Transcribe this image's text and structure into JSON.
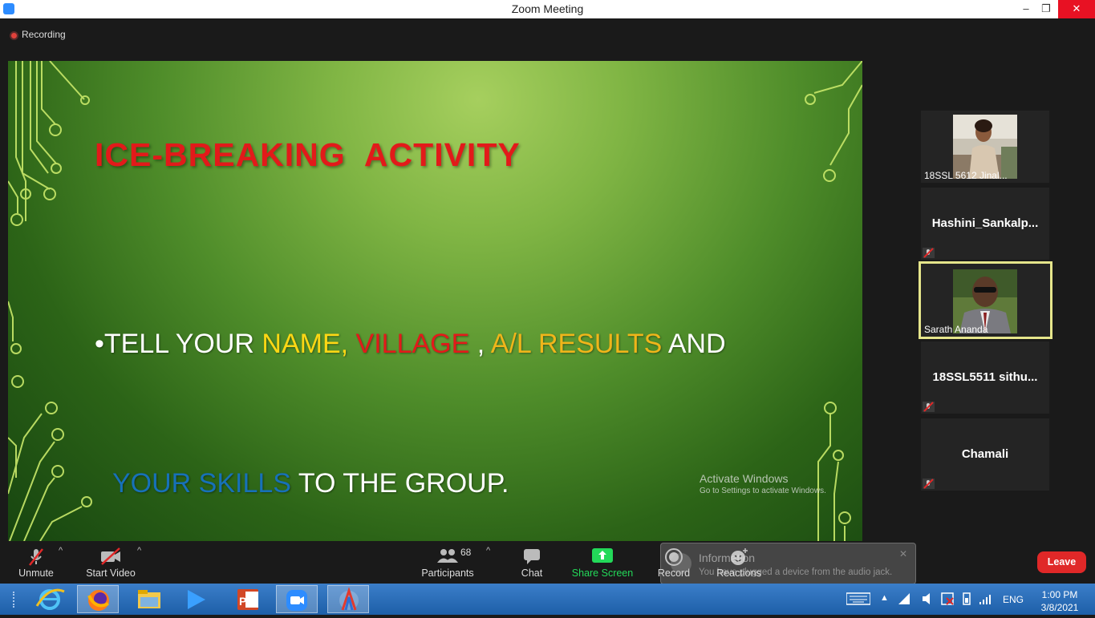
{
  "window": {
    "title": "Zoom Meeting",
    "minimize": "–",
    "restore": "❐",
    "close": "✕"
  },
  "recording": {
    "label": "Recording"
  },
  "slide": {
    "title": "ICE-BREAKING  ACTIVITY",
    "bullet": "•",
    "line1": [
      {
        "text": "TELL YOUR ",
        "color": "white"
      },
      {
        "text": "NAME,",
        "color": "yellow"
      },
      {
        "text": " VILLAGE",
        "color": "red"
      },
      {
        "text": " , ",
        "color": "white"
      },
      {
        "text": "A/L RESULTS",
        "color": "orange"
      },
      {
        "text": " AND",
        "color": "white"
      }
    ],
    "line2": [
      {
        "text": "YOUR SKILLS",
        "color": "blue"
      },
      {
        "text": " TO THE GROUP.",
        "color": "white"
      }
    ],
    "colors": {
      "title": "#e21a1a",
      "yellow": "#ffd714",
      "red": "#e21a1a",
      "orange": "#f0b51a",
      "blue": "#1771b8"
    }
  },
  "watermark": {
    "line1": "Activate Windows",
    "line2": "Go to Settings to activate Windows."
  },
  "participants": [
    {
      "name": "18SSL 5612 Jinal...",
      "has_video": true,
      "muted": false
    },
    {
      "name": "Hashini_Sankalp...",
      "has_video": false,
      "muted": true
    },
    {
      "name": "Sarath Ananda",
      "has_video": true,
      "muted": false,
      "active_speaker": true
    },
    {
      "name": "18SSL5511  sithu...",
      "has_video": false,
      "muted": true
    },
    {
      "name": "Chamali",
      "has_video": false,
      "muted": true
    }
  ],
  "toolbar": {
    "unmute": "Unmute",
    "start_video": "Start Video",
    "participants": "Participants",
    "participant_count": "68",
    "chat": "Chat",
    "share_screen": "Share Screen",
    "record": "Record",
    "reactions": "Reactions",
    "leave": "Leave"
  },
  "notification": {
    "title": "Information",
    "message": "You have plugged a device from the audio jack."
  },
  "taskbar": {
    "apps": [
      "ie-icon",
      "firefox-icon",
      "file-explorer-icon",
      "media-player-icon",
      "powerpoint-icon",
      "zoom-icon",
      "app-icon"
    ],
    "language": "ENG",
    "time": "1:00 PM",
    "date": "3/8/2021"
  },
  "accent_colors": {
    "zoom_blue": "#2d8cff",
    "share_green": "#23d959",
    "leave_red": "#e02828",
    "speaker_border": "#e5e58b"
  }
}
